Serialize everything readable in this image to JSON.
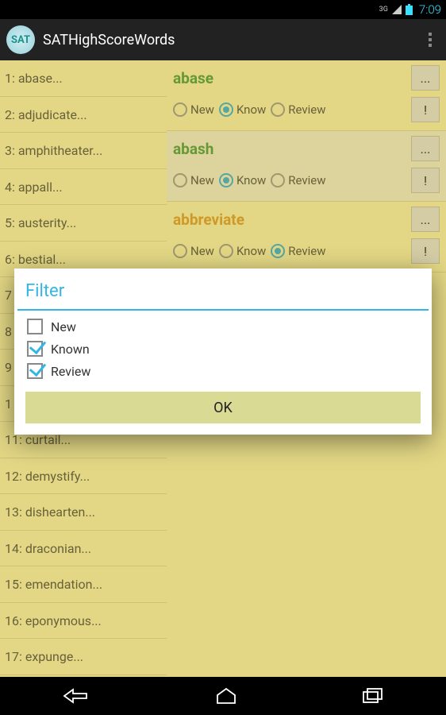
{
  "status": {
    "time": "7:09",
    "network": "3G"
  },
  "actionbar": {
    "icon_text": "SAT",
    "title": "SATHighScoreWords"
  },
  "left_items": [
    "1: abase...",
    "2: adjudicate...",
    "3: amphitheater...",
    "4: appall...",
    "5: austerity...",
    "6: bestial...",
    "7",
    "8",
    "9",
    "1",
    "11: curtail...",
    "12: demystify...",
    "13: dishearten...",
    "14: draconian...",
    "15: emendation...",
    "16: eponymous...",
    "17: expunge..."
  ],
  "cards": [
    {
      "word": "abase",
      "color": "green",
      "radios": [
        "New",
        "Know",
        "Review"
      ],
      "sel": 1,
      "more": "...",
      "bang": "!"
    },
    {
      "word": "abash",
      "color": "green",
      "radios": [
        "New",
        "Know",
        "Review"
      ],
      "sel": 1,
      "more": "...",
      "bang": "!",
      "selected": true
    },
    {
      "word": "abbreviate",
      "color": "orange",
      "radios": [
        "New",
        "Know",
        "Review"
      ],
      "sel": 2,
      "more": "...",
      "bang": "!"
    }
  ],
  "dialog": {
    "title": "Filter",
    "options": [
      {
        "label": "New",
        "checked": false
      },
      {
        "label": "Known",
        "checked": true
      },
      {
        "label": "Review",
        "checked": true
      }
    ],
    "ok": "OK"
  }
}
